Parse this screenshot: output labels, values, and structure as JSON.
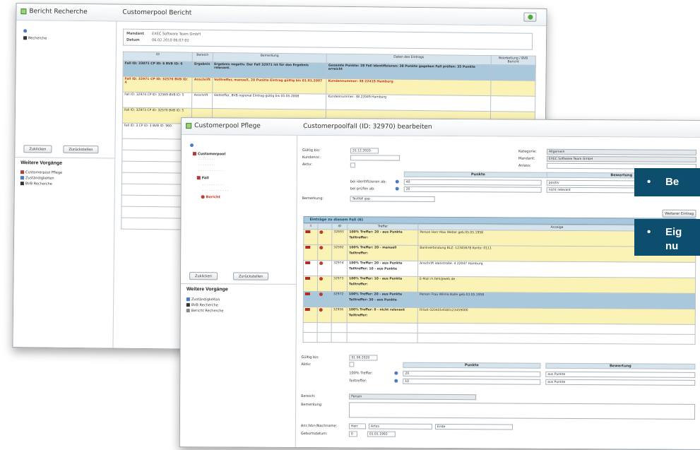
{
  "back_window": {
    "title": "Bericht Recherche",
    "page_title": "Customerpool Bericht",
    "sidebar_tree_root": "Recherche",
    "buttons": {
      "left": "Zuklicken",
      "right": "Zurückstellen"
    },
    "section_heading": "Weitere Vorgänge",
    "nav": [
      "Customerpool Pflege",
      "Zuständigkeiten",
      "BVB Recherche"
    ],
    "info": [
      {
        "label": "Mandant",
        "value": "EXEC Software Team GmbH"
      },
      {
        "label": "Datum",
        "value": "06.02.2010 06:07:02"
      }
    ],
    "table_headers": [
      "ID",
      "Bereich",
      "Bemerkung",
      "Daten des Eintrags",
      "Bearbeitung / BVB Bericht"
    ],
    "rows": [
      {
        "style": "blue",
        "id": "Fall ID: 33071 CP ID: 6 BVB ID: 6",
        "bereich": "Ergebnis",
        "bem": "Ergebnis negativ. Der Fall 32971 ist für das Ergebnis relevant.",
        "daten": "Gesamte Punkte: 28 Fall identifizieren: 38 Punkte gegeben Fall prüfen: 35 Punkte erreicht"
      },
      {
        "style": "yellow",
        "id": "Fall ID: 32971 CP ID: 32576 BVB ID: 4",
        "bereich": "Anschrift",
        "bem": "Volltreffer, manuell, 20 Punkte Eintrag gültig bis 01.01.2007",
        "daten": "Kundennummer: 38 22419 Hamburg"
      },
      {
        "style": "white",
        "id": "Fall ID: 32974 CP ID: 32569 BVB ID: 5",
        "bereich": "Anschrift",
        "bem": "Volltreffer, BVB regional Eintrag gültig bis 05.05.2008",
        "daten": "Kundennummer: 38 22049 Hamburg"
      },
      {
        "style": "yellow",
        "id": "Fall ID: 32973 CP ID: 32570 BVB ID: 5",
        "bereich": "",
        "bem": "",
        "daten": ""
      },
      {
        "style": "white",
        "id": "Fall ID: 3 CP ID: 3 BVB ID: 960",
        "bereich": "",
        "bem": "",
        "daten": ""
      }
    ]
  },
  "front_window": {
    "title": "Customerpool Pflege",
    "page_title": "Customerpoolfall (ID: 32970) bearbeiten",
    "tree": [
      "Customerpool",
      "Fall",
      "Eintrag",
      "Bericht"
    ],
    "buttons": {
      "left": "Zuklicken",
      "right": "Zurückstellen"
    },
    "section_heading": "Weitere Vorgänge",
    "nav": [
      "Zuständigkeiten",
      "BVB Recherche",
      "Bericht Recherche"
    ],
    "form_left": [
      {
        "label": "Gültig bis:",
        "value": "31.12.2020"
      },
      {
        "label": "Kundennr.:",
        "value": ""
      },
      {
        "label": "Aktiv:",
        "value": ""
      }
    ],
    "form_right": [
      {
        "label": "Kategorie:",
        "value": "Allgemein"
      },
      {
        "label": "Mandant:",
        "value": "EXEC Software Team GmbH"
      },
      {
        "label": "Anlass:",
        "value": ""
      }
    ],
    "points_header": "Punkte",
    "rating_header": "Bewertung",
    "points_rows": [
      {
        "label": "bei identifizieren ab:",
        "value": "40",
        "rating": "positiv"
      },
      {
        "label": "bei prüfen ab:",
        "value": "20",
        "rating": "nicht relevant"
      }
    ],
    "remark_label": "Bemerkung:",
    "remark_value": "Testfall gsp",
    "entries_tab": "Einträge zu diesem Fall (6)",
    "entries_button": "Weiterer Eintrag",
    "entries_headers": [
      "X",
      "",
      "ID",
      "Treffer",
      "Anzeige"
    ],
    "entries": [
      {
        "style": "yellow",
        "id": "32693",
        "treffer": "100% Treffer: 20 - aus Punkte",
        "sub": "Teiltreffer:",
        "anzeige": "Person Herr Max Weller geb.05.05.1958"
      },
      {
        "style": "yellow",
        "id": "32592",
        "treffer": "100% Treffer: 20 - manuell",
        "sub": "Teiltreffer:",
        "anzeige": "Bankverbindung BLZ: 12345678 Konto: 0111"
      },
      {
        "style": "white",
        "id": "32974",
        "treffer": "100% Treffer: 20 - aus Punkte",
        "sub": "Teiltreffer: 10 - aus Punkte",
        "anzeige": "Anschrift Idenstraße. 4 22047 Hamburg"
      },
      {
        "style": "yellow",
        "id": "32973",
        "treffer": "100% Treffer: 10 - aus Punkte",
        "sub": "Teiltreffer:",
        "anzeige": "E-Mail m.fehl@web.de"
      },
      {
        "style": "blue",
        "id": "32972",
        "treffer": "100% Treffer: 20 - aus Punkte",
        "sub": "Teiltreffer: 30 - aus Punkte",
        "anzeige": "Person Frau Wilma Balle geb.03.05.1958"
      },
      {
        "style": "yellow",
        "id": "32956",
        "treffer": "100% Treffer: 0 - nicht relevant",
        "sub": "Teiltreffer:",
        "anzeige": "Fillialt 0204054580123459000"
      }
    ],
    "lower_left": [
      {
        "label": "Gültig bis:",
        "value": "01.06.2020"
      },
      {
        "label": "Aktiv:",
        "value": ""
      }
    ],
    "lower_points": [
      {
        "label": "100% Treffer:",
        "value": "20",
        "rating": "aus Punkte"
      },
      {
        "label": "Teiltreffer:",
        "value": "10",
        "rating": "aus Punkte"
      }
    ],
    "bereich_label": "Bereich:",
    "bereich_value": "Person",
    "bemerkung_label": "Bemerkung:",
    "name_label": "Anr./Vor-/Nachname:",
    "name_values": [
      "Herr",
      "Artus",
      "Ende"
    ],
    "geb_label": "Geburtsdatum:",
    "geb_values": [
      "0",
      "01.01.1993"
    ]
  },
  "callout": {
    "items": [
      "Be",
      "Eig",
      "nu"
    ],
    "bullet": "•"
  },
  "colors": {
    "callout_bg": "#0d4d6e",
    "row_blue": "#a9c8dc",
    "row_yellow": "#fbf3b5",
    "accent_red": "#c0392b"
  }
}
